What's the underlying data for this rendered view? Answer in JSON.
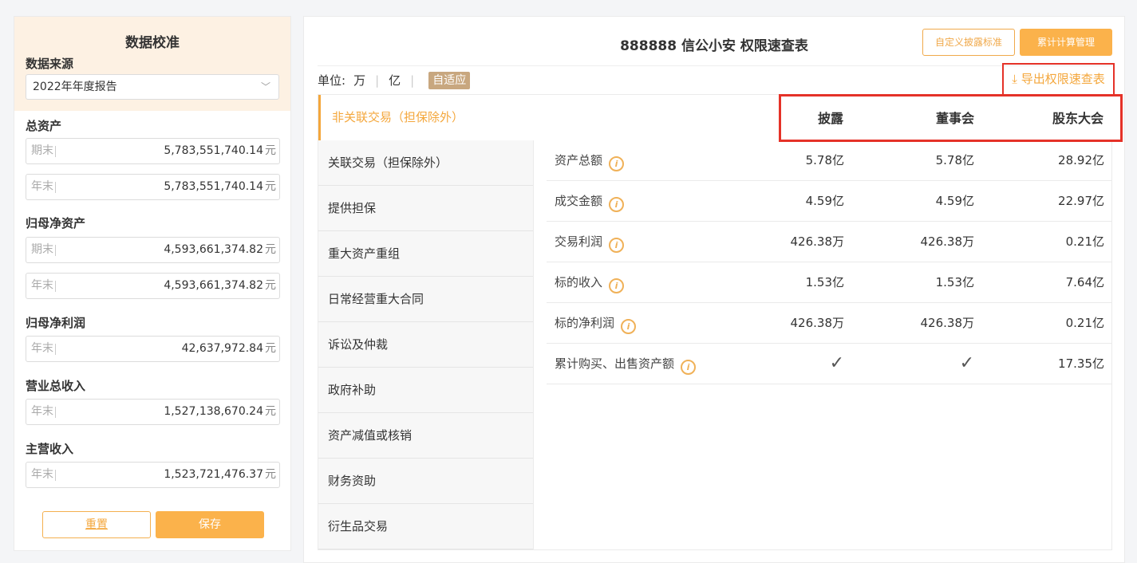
{
  "sidebar": {
    "title": "数据校准",
    "source_label": "数据来源",
    "source_value": "2022年年度报告",
    "groups": [
      {
        "label": "总资产",
        "fields": [
          {
            "ph": "期末",
            "value": "5,783,551,740.14",
            "unit": "元"
          },
          {
            "ph": "年末",
            "value": "5,783,551,740.14",
            "unit": "元"
          }
        ]
      },
      {
        "label": "归母净资产",
        "fields": [
          {
            "ph": "期末",
            "value": "4,593,661,374.82",
            "unit": "元"
          },
          {
            "ph": "年末",
            "value": "4,593,661,374.82",
            "unit": "元"
          }
        ]
      },
      {
        "label": "归母净利润",
        "fields": [
          {
            "ph": "年末",
            "value": "42,637,972.84",
            "unit": "元"
          }
        ]
      },
      {
        "label": "营业总收入",
        "fields": [
          {
            "ph": "年末",
            "value": "1,527,138,670.24",
            "unit": "元"
          }
        ]
      },
      {
        "label": "主营收入",
        "fields": [
          {
            "ph": "年末",
            "value": "1,523,721,476.37",
            "unit": "元"
          }
        ]
      }
    ],
    "reset_label": "重置",
    "save_label": "保存"
  },
  "main": {
    "title": "888888 信公小安 权限速查表",
    "custom_btn": "自定义披露标准",
    "accum_btn": "累计计算管理",
    "unit_label": "单位:",
    "unit_wan": "万",
    "unit_yi": "亿",
    "unit_adaptive": "自适应",
    "export_label": "导出权限速查表",
    "categories": [
      "非关联交易（担保除外）",
      "关联交易（担保除外）",
      "提供担保",
      "重大资产重组",
      "日常经营重大合同",
      "诉讼及仲裁",
      "政府补助",
      "资产减值或核销",
      "财务资助",
      "衍生品交易"
    ],
    "columns": [
      "披露",
      "董事会",
      "股东大会"
    ],
    "rows": [
      {
        "label": "资产总额",
        "c1": "5.78亿",
        "c2": "5.78亿",
        "c3": "28.92亿"
      },
      {
        "label": "成交金额",
        "c1": "4.59亿",
        "c2": "4.59亿",
        "c3": "22.97亿"
      },
      {
        "label": "交易利润",
        "c1": "426.38万",
        "c2": "426.38万",
        "c3": "0.21亿"
      },
      {
        "label": "标的收入",
        "c1": "1.53亿",
        "c2": "1.53亿",
        "c3": "7.64亿"
      },
      {
        "label": "标的净利润",
        "c1": "426.38万",
        "c2": "426.38万",
        "c3": "0.21亿"
      },
      {
        "label": "累计购买、出售资产额",
        "c1": "✓",
        "c2": "✓",
        "c3": "17.35亿"
      }
    ],
    "info_glyph": "i"
  },
  "icons": {
    "chevron": "﹀",
    "download": "⤓"
  },
  "colors": {
    "accent": "#f4a73c",
    "highlight": "#e53228",
    "header_bg": "#fdf1e3"
  }
}
